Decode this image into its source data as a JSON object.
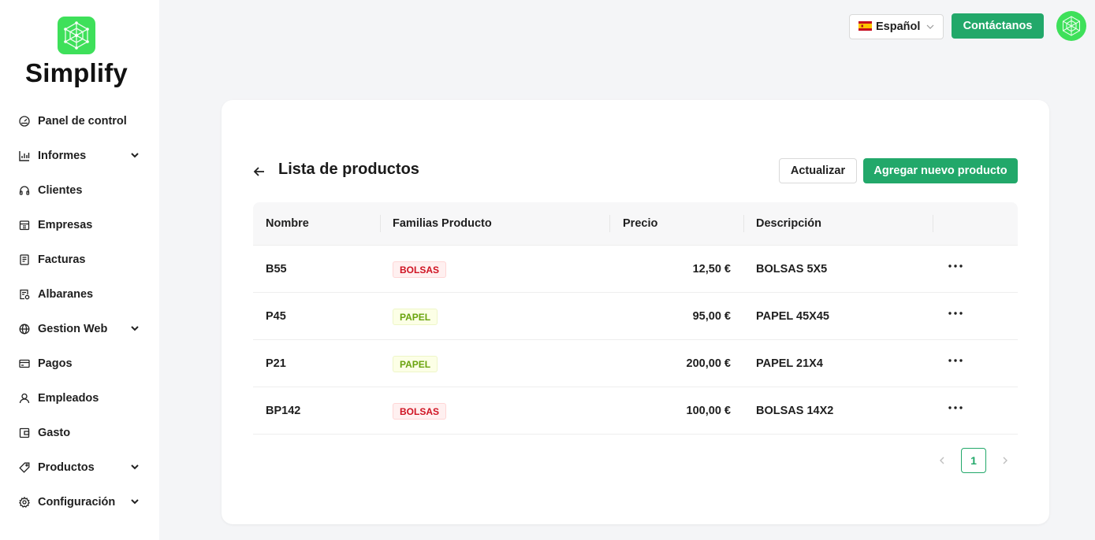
{
  "brand": {
    "name": "Simplify",
    "logo_icon": "network-logo-icon",
    "logo_color": "#3ee05a"
  },
  "sidebar": {
    "items": [
      {
        "label": "Panel de control",
        "icon": "dashboard-icon",
        "expandable": false
      },
      {
        "label": "Informes",
        "icon": "bar-chart-icon",
        "expandable": true
      },
      {
        "label": "Clientes",
        "icon": "headset-icon",
        "expandable": false
      },
      {
        "label": "Empresas",
        "icon": "building-icon",
        "expandable": false
      },
      {
        "label": "Facturas",
        "icon": "invoice-icon",
        "expandable": false
      },
      {
        "label": "Albaranes",
        "icon": "delivery-note-icon",
        "expandable": false
      },
      {
        "label": "Gestion Web",
        "icon": "globe-icon",
        "expandable": true
      },
      {
        "label": "Pagos",
        "icon": "credit-card-icon",
        "expandable": false
      },
      {
        "label": "Empleados",
        "icon": "user-icon",
        "expandable": false
      },
      {
        "label": "Gasto",
        "icon": "wallet-icon",
        "expandable": false
      },
      {
        "label": "Productos",
        "icon": "tag-icon",
        "expandable": true
      },
      {
        "label": "Configuración",
        "icon": "gear-icon",
        "expandable": true
      }
    ]
  },
  "header": {
    "language": {
      "flag": "spain-flag-icon",
      "label": "Español"
    },
    "contact_label": "Contáctanos",
    "avatar_icon": "network-avatar-icon"
  },
  "main": {
    "title": "Lista de productos",
    "refresh_label": "Actualizar",
    "add_label": "Agregar nuevo producto",
    "table": {
      "columns": [
        "Nombre",
        "Familias Producto",
        "Precio",
        "Descripción"
      ],
      "rows": [
        {
          "name": "B55",
          "family": "BOLSAS",
          "family_color": "red",
          "price": "12,50 €",
          "description": "BOLSAS 5X5"
        },
        {
          "name": "P45",
          "family": "PAPEL",
          "family_color": "green",
          "price": "95,00 €",
          "description": "PAPEL 45X45"
        },
        {
          "name": "P21",
          "family": "PAPEL",
          "family_color": "green",
          "price": "200,00 €",
          "description": "PAPEL 21X4"
        },
        {
          "name": "BP142",
          "family": "BOLSAS",
          "family_color": "red",
          "price": "100,00 €",
          "description": "BOLSAS 14X2"
        }
      ]
    },
    "pagination": {
      "current_page": "1"
    }
  },
  "colors": {
    "accent": "#22a86a",
    "tag_red": "#cf1322",
    "tag_green": "#6aa30e"
  }
}
